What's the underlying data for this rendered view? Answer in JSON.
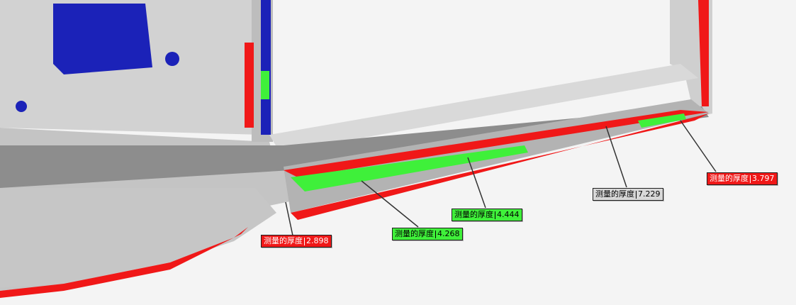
{
  "colors": {
    "background": "#f4f4f4",
    "part_surface": "#c9c9c9",
    "pass_green": "#3ff03a",
    "fail_red": "#f01818",
    "info_gray": "#d8d8d8",
    "cavity_blue": "#1b22b8"
  },
  "callouts": [
    {
      "id": "callout-2898",
      "label": "测量的厚度",
      "value": "2.898",
      "status": "red"
    },
    {
      "id": "callout-4268",
      "label": "测量的厚度",
      "value": "4.268",
      "status": "green"
    },
    {
      "id": "callout-4444",
      "label": "测量的厚度",
      "value": "4.444",
      "status": "green"
    },
    {
      "id": "callout-7229",
      "label": "测量的厚度",
      "value": "7.229",
      "status": "gray"
    },
    {
      "id": "callout-3797",
      "label": "测量的厚度",
      "value": "3.797",
      "status": "red"
    }
  ]
}
